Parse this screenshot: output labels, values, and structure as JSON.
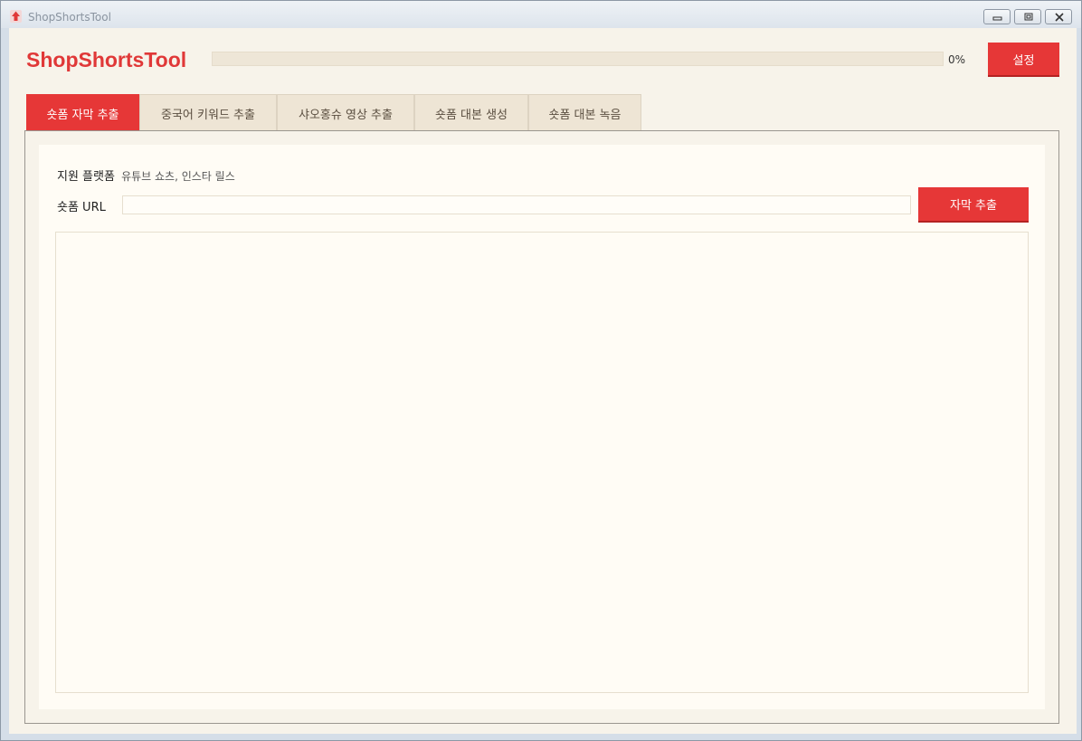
{
  "window": {
    "title": "ShopShortsTool",
    "icon": "app-logo-icon",
    "controls": [
      "minimize-icon",
      "maximize-icon",
      "close-icon"
    ]
  },
  "header": {
    "brand": "ShopShortsTool",
    "progress_percent": 0,
    "progress_text": "0%",
    "settings_label": "설정"
  },
  "tabs": [
    {
      "label": "숏폼 자막 추출",
      "active": true
    },
    {
      "label": "중국어 키워드 추출",
      "active": false
    },
    {
      "label": "샤오홍슈 영상 추출",
      "active": false
    },
    {
      "label": "숏폼 대본 생성",
      "active": false
    },
    {
      "label": "숏폼 대본 녹음",
      "active": false
    }
  ],
  "form": {
    "platform_label": "지원 플랫폼",
    "platform_value": "유튜브 쇼츠, 인스타 릴스",
    "url_label": "숏폼 URL",
    "url_value": "",
    "extract_button": "자막 추출",
    "output_value": ""
  },
  "colors": {
    "accent": "#e63737",
    "background": "#f7f3ea",
    "panel": "#fffcf5",
    "tab_inactive": "#eee5d5"
  }
}
